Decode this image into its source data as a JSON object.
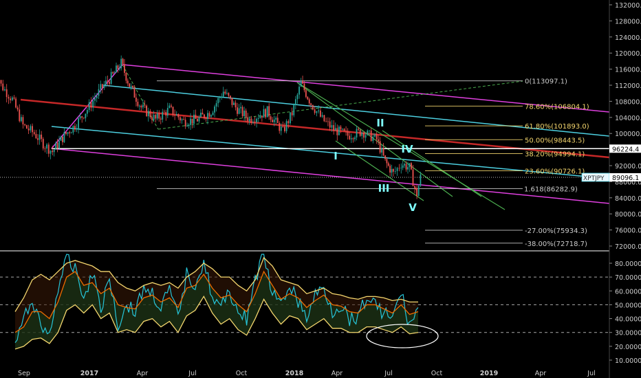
{
  "colors": {
    "background": "#000000",
    "candle_up": "#26a69a",
    "candle_down": "#ef5350",
    "fib_yellow": "#f5d76e",
    "fib_white": "#cccccc",
    "channel_magenta": "#e040e0",
    "channel_cyan": "#4dd0e1",
    "regression_red": "#c62828",
    "green_lines": "#4caf50",
    "wave_label": "#7fffff",
    "price_tag_bg": "#e8f8ff",
    "level_tag_bg": "#ffffff"
  },
  "chart_data": [
    {
      "type": "candlestick",
      "symbol": "XPTJPY",
      "ylim": [
        72000,
        133000
      ],
      "y_axis_ticks": [
        "132000.0",
        "128000.0",
        "124000.0",
        "120000.0",
        "116000.0",
        "112000.0",
        "108000.0",
        "104000.0",
        "100000.0",
        "96000.0",
        "92000.0",
        "88000.0",
        "84000.0",
        "80000.0",
        "76000.0",
        "72000.0"
      ],
      "x_axis_ticks": [
        "Sep",
        "2017",
        "Apr",
        "Jul",
        "Oct",
        "2018",
        "Apr",
        "Jul",
        "Oct",
        "2019",
        "Apr",
        "Jul"
      ],
      "price_tags": {
        "current_label": "XPTJPY",
        "current_value": "89096.1",
        "level_value": "96224.4"
      },
      "fib_levels": [
        {
          "label": "0(113097.1)",
          "value": 113097.1,
          "color": "#cccccc"
        },
        {
          "label": "78.60%(106804.1)",
          "value": 106804.1,
          "color": "#f5d76e"
        },
        {
          "label": "61.80%(101893.0)",
          "value": 101893.0,
          "color": "#f5d76e"
        },
        {
          "label": "50.00%(98443.5)",
          "value": 98443.5,
          "color": "#f5d76e"
        },
        {
          "label": "38.20%(94994.1)",
          "value": 94994.1,
          "color": "#f5d76e"
        },
        {
          "label": "23.60%(90726.1)",
          "value": 90726.1,
          "color": "#f5d76e"
        },
        {
          "label": "1.618(86282.9)",
          "value": 86282.9,
          "color": "#cccccc"
        },
        {
          "label": "-27.00%(75934.3)",
          "value": 75934.3,
          "color": "#cccccc"
        },
        {
          "label": "-38.00%(72718.7)",
          "value": 72718.7,
          "color": "#cccccc"
        }
      ],
      "wave_labels": [
        "I",
        "II",
        "III",
        "IV",
        "V"
      ],
      "price_path": [
        {
          "x": "2016-07-04",
          "y": 119500
        },
        {
          "x": "2016-07-20",
          "y": 112000
        },
        {
          "x": "2016-08-10",
          "y": 108500
        },
        {
          "x": "2016-08-30",
          "y": 102000
        },
        {
          "x": "2016-09-20",
          "y": 100000
        },
        {
          "x": "2016-10-10",
          "y": 97000
        },
        {
          "x": "2016-10-24",
          "y": 95500
        },
        {
          "x": "2016-11-15",
          "y": 99500
        },
        {
          "x": "2016-12-05",
          "y": 102000
        },
        {
          "x": "2016-12-28",
          "y": 106000
        },
        {
          "x": "2017-01-20",
          "y": 111000
        },
        {
          "x": "2017-02-10",
          "y": 114500
        },
        {
          "x": "2017-02-24",
          "y": 117500
        },
        {
          "x": "2017-03-10",
          "y": 112000
        },
        {
          "x": "2017-03-30",
          "y": 106500
        },
        {
          "x": "2017-04-25",
          "y": 103500
        },
        {
          "x": "2017-05-20",
          "y": 106000
        },
        {
          "x": "2017-06-15",
          "y": 103000
        },
        {
          "x": "2017-07-10",
          "y": 103500
        },
        {
          "x": "2017-08-05",
          "y": 105500
        },
        {
          "x": "2017-08-28",
          "y": 110500
        },
        {
          "x": "2017-09-20",
          "y": 106500
        },
        {
          "x": "2017-10-15",
          "y": 103500
        },
        {
          "x": "2017-11-15",
          "y": 105500
        },
        {
          "x": "2017-12-12",
          "y": 100500
        },
        {
          "x": "2017-12-28",
          "y": 105000
        },
        {
          "x": "2018-01-15",
          "y": 112500
        },
        {
          "x": "2018-02-05",
          "y": 107500
        },
        {
          "x": "2018-03-01",
          "y": 103500
        },
        {
          "x": "2018-03-25",
          "y": 101000
        },
        {
          "x": "2018-04-20",
          "y": 99500
        },
        {
          "x": "2018-05-15",
          "y": 100500
        },
        {
          "x": "2018-06-10",
          "y": 98500
        },
        {
          "x": "2018-06-25",
          "y": 93000
        },
        {
          "x": "2018-07-10",
          "y": 90000
        },
        {
          "x": "2018-07-25",
          "y": 92500
        },
        {
          "x": "2018-08-10",
          "y": 91500
        },
        {
          "x": "2018-08-20",
          "y": 86500
        },
        {
          "x": "2018-08-24",
          "y": 85000
        },
        {
          "x": "2018-08-31",
          "y": 89096
        }
      ]
    },
    {
      "type": "line",
      "panel": "oscillator",
      "ylim": [
        8,
        90
      ],
      "y_axis_ticks": [
        "80.0000",
        "70.0000",
        "60.0000",
        "50.0000",
        "40.0000",
        "30.0000",
        "20.0000",
        "10.0000"
      ],
      "reference_lines": [
        70,
        50,
        30
      ],
      "series": [
        {
          "color": "#26c6da",
          "values": [
            22,
            38,
            55,
            34,
            28,
            62,
            82,
            78,
            55,
            74,
            48,
            70,
            35,
            50,
            45,
            62,
            58,
            48,
            60,
            40,
            72,
            65,
            82,
            55,
            47,
            60,
            45,
            40,
            68,
            86,
            58,
            48,
            65,
            52,
            40,
            57,
            62,
            45,
            50,
            40,
            42,
            56,
            50,
            44,
            40,
            58,
            35,
            48
          ]
        },
        {
          "color": "#ef6c00",
          "values": [
            30,
            34,
            45,
            45,
            40,
            52,
            70,
            74,
            64,
            66,
            58,
            62,
            50,
            48,
            47,
            55,
            57,
            52,
            55,
            48,
            62,
            64,
            72,
            62,
            55,
            57,
            50,
            45,
            58,
            74,
            64,
            54,
            58,
            55,
            48,
            53,
            57,
            50,
            49,
            45,
            44,
            50,
            50,
            47,
            44,
            50,
            43,
            45
          ]
        },
        {
          "color": "#f5d76e",
          "values": [
            45,
            55,
            68,
            72,
            68,
            74,
            80,
            82,
            80,
            78,
            74,
            74,
            66,
            62,
            60,
            64,
            66,
            64,
            66,
            62,
            70,
            74,
            80,
            76,
            70,
            70,
            64,
            60,
            68,
            84,
            78,
            68,
            66,
            64,
            58,
            60,
            62,
            58,
            57,
            55,
            54,
            56,
            56,
            55,
            53,
            54,
            52,
            52
          ]
        },
        {
          "color": "#f5d76e",
          "values": [
            18,
            20,
            25,
            26,
            22,
            30,
            46,
            50,
            44,
            50,
            40,
            44,
            30,
            32,
            30,
            38,
            40,
            34,
            38,
            30,
            42,
            46,
            56,
            44,
            36,
            40,
            32,
            28,
            40,
            54,
            44,
            36,
            42,
            40,
            32,
            36,
            40,
            33,
            33,
            30,
            30,
            34,
            34,
            32,
            30,
            34,
            29,
            30
          ]
        }
      ]
    }
  ]
}
